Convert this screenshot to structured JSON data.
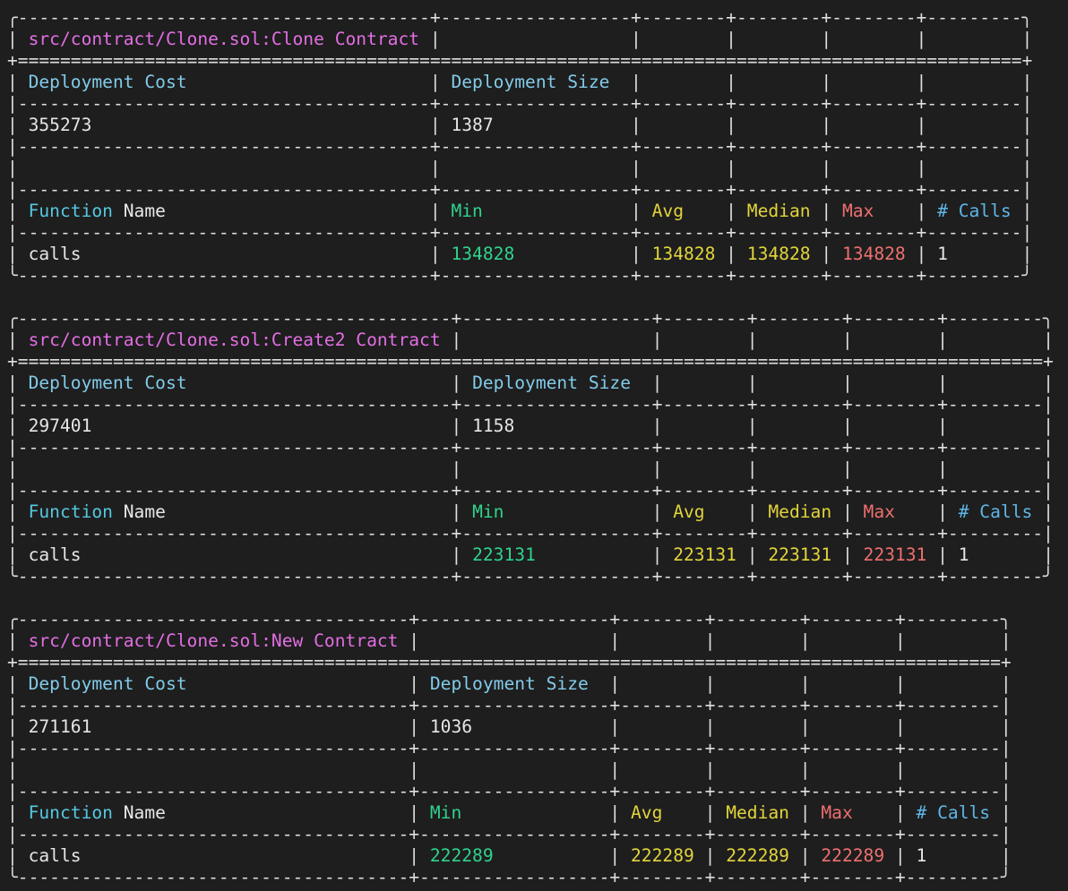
{
  "colors": {
    "background": "#1e1e1e",
    "border": "#dedede",
    "title": "#e36ee3",
    "header": "#82cbe9",
    "function_header": "#55c8e0",
    "min": "#2fd38c",
    "avg": "#e2d43c",
    "median": "#e2d43c",
    "max": "#ef6f6f",
    "calls_header": "#5fb6e6",
    "value": "#e6e6e6"
  },
  "labels": {
    "deployment_cost": "Deployment Cost",
    "deployment_size": "Deployment Size",
    "function": "Function",
    "name": "Name",
    "min": "Min",
    "avg": "Avg",
    "median": "Median",
    "max": "Max",
    "calls": "# Calls"
  },
  "reports": [
    {
      "title": "src/contract/Clone.sol:Clone Contract",
      "deployment_cost": "355273",
      "deployment_size": "1387",
      "functions": [
        {
          "name": "calls",
          "min": "134828",
          "avg": "134828",
          "median": "134828",
          "max": "134828",
          "calls": "1"
        }
      ]
    },
    {
      "title": "src/contract/Clone.sol:Create2 Contract",
      "deployment_cost": "297401",
      "deployment_size": "1158",
      "functions": [
        {
          "name": "calls",
          "min": "223131",
          "avg": "223131",
          "median": "223131",
          "max": "223131",
          "calls": "1"
        }
      ]
    },
    {
      "title": "src/contract/Clone.sol:New Contract",
      "deployment_cost": "271161",
      "deployment_size": "1036",
      "functions": [
        {
          "name": "calls",
          "min": "222289",
          "avg": "222289",
          "median": "222289",
          "max": "222289",
          "calls": "1"
        }
      ]
    }
  ]
}
